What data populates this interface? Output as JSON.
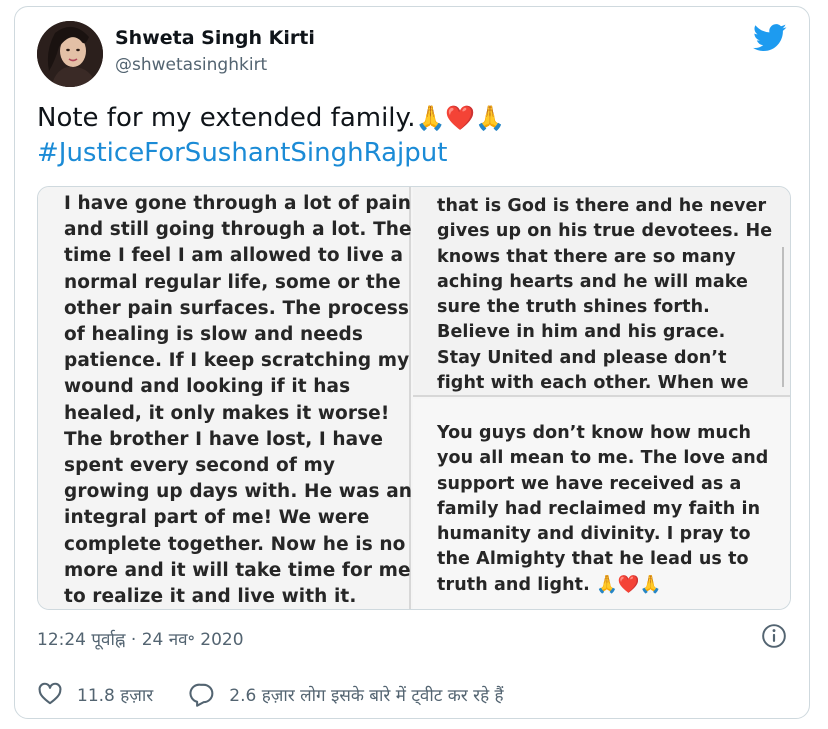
{
  "author": {
    "display_name": "Shweta Singh Kirti",
    "handle": "@shwetasinghkirt",
    "avatar_icon": "profile-photo"
  },
  "logo_icon": "twitter-bird-icon",
  "tweet": {
    "text": "Note for my extended family.",
    "emojis": "🙏❤️🙏",
    "hashtag": "#JusticeForSushantSinghRajput"
  },
  "media": {
    "left_panel": {
      "lines": [
        "I have gone through a lot of pain",
        "and still going through a lot. The",
        "time I feel I am allowed to live a",
        "normal regular life, some or the",
        "other pain surfaces. The process",
        "of healing is slow and needs",
        "patience. If I keep scratching my",
        "wound and looking if it has",
        "healed, it only makes it worse!",
        "The brother I have lost, I have",
        "spent every second of my",
        "growing up days with. He was an",
        "integral part of me! We were",
        "complete together. Now he is no",
        "more and it will take time for me",
        "to realize it and live with it."
      ]
    },
    "right_top_panel": {
      "lines": [
        "that is God is there and he never",
        "gives up on his true devotees. He",
        "knows that there are so many",
        "aching hearts and he will make",
        "sure the truth shines forth.",
        "Believe in him and his grace.",
        "Stay United and please don’t",
        "fight with each other. When we"
      ]
    },
    "right_bottom_panel": {
      "lines": [
        "You guys don’t know how much",
        "you all mean to me. The love and",
        "support we have received as a",
        "family had reclaimed my faith in",
        "humanity and divinity.  I pray to",
        "the Almighty that he lead us to",
        "truth and light. 🙏❤️🙏"
      ]
    }
  },
  "timestamp": "12:24 पूर्वाह्न · 24 नव॰ 2020",
  "info_icon": "info-icon",
  "actions": {
    "likes": "11.8 हज़ार",
    "replies_text": "2.6 हज़ार लोग इसके बारे में ट्वीट कर रहे हैं"
  },
  "colors": {
    "brand_blue": "#1d9bf0",
    "hashtag": "#1b8bd6",
    "like_red": "#e0245e",
    "secondary_text": "#536471"
  }
}
